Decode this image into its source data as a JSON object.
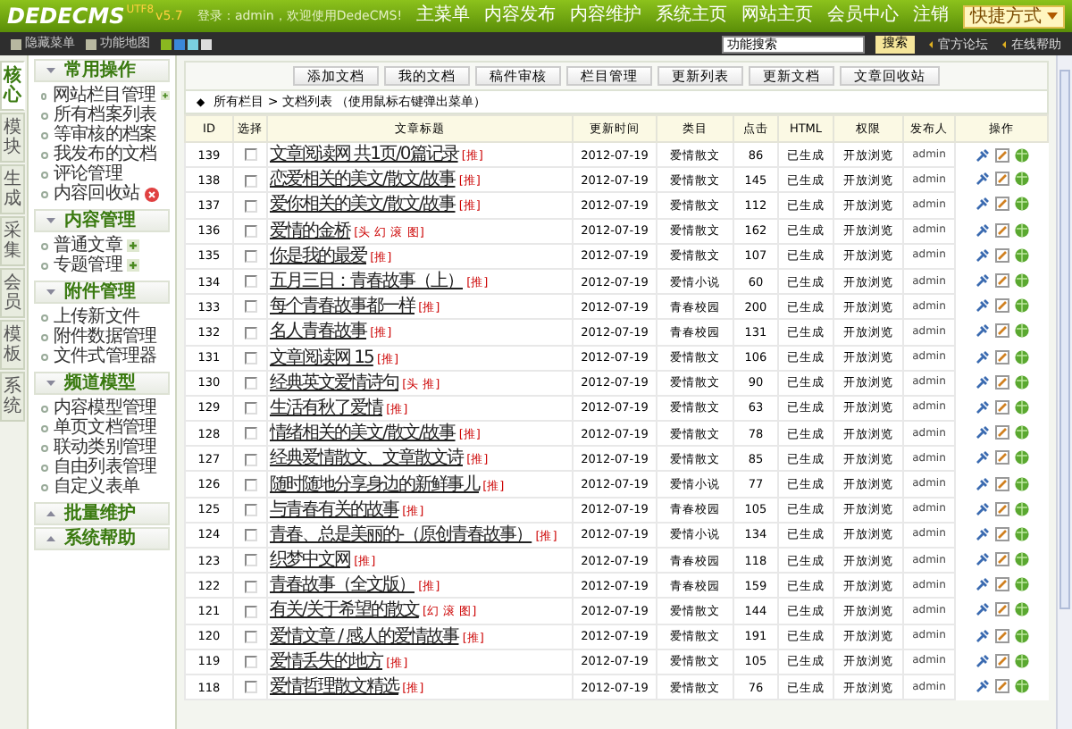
{
  "header": {
    "logo": "DEDECMS",
    "version": "v5.7",
    "edition": "UTF8",
    "welcome": "登录：admin，欢迎使用DedeCMS!",
    "nav": [
      "主菜单",
      "内容发布",
      "内容维护",
      "系统主页",
      "网站主页",
      "会员中心",
      "注销"
    ],
    "quick_menu": "快捷方式"
  },
  "toolbar": {
    "hide_menu": "隐藏菜单",
    "function_map": "功能地图",
    "search": {
      "value": "功能搜索"
    },
    "search_button": "搜索",
    "links": [
      "官方论坛",
      "在线帮助"
    ]
  },
  "side_tabs": [
    {
      "label": "核心",
      "selected": true
    },
    {
      "label": "模块",
      "selected": false
    },
    {
      "label": "生成",
      "selected": false
    },
    {
      "label": "采集",
      "selected": false
    },
    {
      "label": "会员",
      "selected": false
    },
    {
      "label": "模板",
      "selected": false
    },
    {
      "label": "系统",
      "selected": false
    }
  ],
  "sidebar": [
    {
      "title": "常用操作",
      "expanded": true,
      "items": [
        {
          "label": "网站栏目管理",
          "kind": "add"
        },
        {
          "label": "所有档案列表",
          "kind": "plain"
        },
        {
          "label": "等审核的档案",
          "kind": "plain"
        },
        {
          "label": "我发布的文档",
          "kind": "plain"
        },
        {
          "label": "评论管理",
          "kind": "plain"
        },
        {
          "label": "内容回收站",
          "kind": "delete"
        }
      ]
    },
    {
      "title": "内容管理",
      "expanded": true,
      "items": [
        {
          "label": "普通文章",
          "kind": "add"
        },
        {
          "label": "专题管理",
          "kind": "add"
        }
      ]
    },
    {
      "title": "附件管理",
      "expanded": true,
      "items": [
        {
          "label": "上传新文件",
          "kind": "plain"
        },
        {
          "label": "附件数据管理",
          "kind": "plain"
        },
        {
          "label": "文件式管理器",
          "kind": "plain"
        }
      ]
    },
    {
      "title": "频道模型",
      "expanded": true,
      "items": [
        {
          "label": "内容模型管理",
          "kind": "plain"
        },
        {
          "label": "单页文档管理",
          "kind": "plain"
        },
        {
          "label": "联动类别管理",
          "kind": "plain"
        },
        {
          "label": "自由列表管理",
          "kind": "plain"
        },
        {
          "label": "自定义表单",
          "kind": "plain"
        }
      ]
    },
    {
      "title": "批量维护",
      "expanded": false
    },
    {
      "title": "系统帮助",
      "expanded": false
    }
  ],
  "actions": [
    "添加文档",
    "我的文档",
    "稿件审核",
    "栏目管理",
    "更新列表",
    "更新文档",
    "文章回收站"
  ],
  "breadcrumb_marker": "◆",
  "breadcrumb": "所有栏目 > 文档列表 （使用鼠标右键弹出菜单）",
  "table": {
    "columns": [
      "ID",
      "选择",
      "文章标题",
      "更新时间",
      "类目",
      "点击",
      "HTML",
      "权限",
      "发布人",
      "操作"
    ],
    "rows": [
      {
        "id": "139",
        "selected": false,
        "title": "文章阅读网 共1页/0篇记录",
        "flags": "[推]",
        "date": "2012-07-19",
        "category": "爱情散文",
        "clicks": "86",
        "html": "已生成",
        "access": "开放浏览",
        "author": "admin"
      },
      {
        "id": "138",
        "selected": false,
        "title": "恋爱相关的美文/散文/故事",
        "flags": "[推]",
        "date": "2012-07-19",
        "category": "爱情散文",
        "clicks": "145",
        "html": "已生成",
        "access": "开放浏览",
        "author": "admin"
      },
      {
        "id": "137",
        "selected": false,
        "title": "爱你相关的美文/散文/故事",
        "flags": "[推]",
        "date": "2012-07-19",
        "category": "爱情散文",
        "clicks": "112",
        "html": "已生成",
        "access": "开放浏览",
        "author": "admin"
      },
      {
        "id": "136",
        "selected": false,
        "title": "爱情的金桥",
        "flags": "[头 幻 滚 图]",
        "date": "2012-07-19",
        "category": "爱情散文",
        "clicks": "162",
        "html": "已生成",
        "access": "开放浏览",
        "author": "admin"
      },
      {
        "id": "135",
        "selected": false,
        "title": "你是我的最爱",
        "flags": "[推]",
        "date": "2012-07-19",
        "category": "爱情散文",
        "clicks": "107",
        "html": "已生成",
        "access": "开放浏览",
        "author": "admin"
      },
      {
        "id": "134",
        "selected": false,
        "title": "五月三日：青春故事（上）",
        "flags": "[推]",
        "date": "2012-07-19",
        "category": "爱情小说",
        "clicks": "60",
        "html": "已生成",
        "access": "开放浏览",
        "author": "admin"
      },
      {
        "id": "133",
        "selected": false,
        "title": "每个青春故事都一样",
        "flags": "[推]",
        "date": "2012-07-19",
        "category": "青春校园",
        "clicks": "200",
        "html": "已生成",
        "access": "开放浏览",
        "author": "admin"
      },
      {
        "id": "132",
        "selected": false,
        "title": "名人青春故事",
        "flags": "[推]",
        "date": "2012-07-19",
        "category": "青春校园",
        "clicks": "131",
        "html": "已生成",
        "access": "开放浏览",
        "author": "admin"
      },
      {
        "id": "131",
        "selected": false,
        "title": "文章阅读网 15",
        "flags": "[推]",
        "date": "2012-07-19",
        "category": "爱情散文",
        "clicks": "106",
        "html": "已生成",
        "access": "开放浏览",
        "author": "admin"
      },
      {
        "id": "130",
        "selected": false,
        "title": "经典英文爱情诗句",
        "flags": "[头 推]",
        "date": "2012-07-19",
        "category": "爱情散文",
        "clicks": "90",
        "html": "已生成",
        "access": "开放浏览",
        "author": "admin"
      },
      {
        "id": "129",
        "selected": false,
        "title": "生活有秋了爱情",
        "flags": "[推]",
        "date": "2012-07-19",
        "category": "爱情散文",
        "clicks": "63",
        "html": "已生成",
        "access": "开放浏览",
        "author": "admin"
      },
      {
        "id": "128",
        "selected": false,
        "title": "情绪相关的美文/散文/故事",
        "flags": "[推]",
        "date": "2012-07-19",
        "category": "爱情散文",
        "clicks": "78",
        "html": "已生成",
        "access": "开放浏览",
        "author": "admin"
      },
      {
        "id": "127",
        "selected": false,
        "title": "经典爱情散文、文章散文诗",
        "flags": "[推]",
        "date": "2012-07-19",
        "category": "爱情散文",
        "clicks": "85",
        "html": "已生成",
        "access": "开放浏览",
        "author": "admin"
      },
      {
        "id": "126",
        "selected": false,
        "title": "随时随地分享身边的新鲜事儿",
        "flags": "[推]",
        "date": "2012-07-19",
        "category": "爱情小说",
        "clicks": "77",
        "html": "已生成",
        "access": "开放浏览",
        "author": "admin"
      },
      {
        "id": "125",
        "selected": false,
        "title": "与青春有关的故事",
        "flags": "[推]",
        "date": "2012-07-19",
        "category": "青春校园",
        "clicks": "105",
        "html": "已生成",
        "access": "开放浏览",
        "author": "admin"
      },
      {
        "id": "124",
        "selected": false,
        "title": "青春、总是美丽的-（原创青春故事）",
        "flags": "[推]",
        "date": "2012-07-19",
        "category": "爱情小说",
        "clicks": "134",
        "html": "已生成",
        "access": "开放浏览",
        "author": "admin"
      },
      {
        "id": "123",
        "selected": false,
        "title": "织梦中文网",
        "flags": "[推]",
        "date": "2012-07-19",
        "category": "青春校园",
        "clicks": "118",
        "html": "已生成",
        "access": "开放浏览",
        "author": "admin"
      },
      {
        "id": "122",
        "selected": false,
        "title": "青春故事（全文版）",
        "flags": "[推]",
        "date": "2012-07-19",
        "category": "青春校园",
        "clicks": "159",
        "html": "已生成",
        "access": "开放浏览",
        "author": "admin"
      },
      {
        "id": "121",
        "selected": false,
        "title": "有关/关于希望的散文",
        "flags": "[幻 滚 图]",
        "date": "2012-07-19",
        "category": "爱情散文",
        "clicks": "144",
        "html": "已生成",
        "access": "开放浏览",
        "author": "admin"
      },
      {
        "id": "120",
        "selected": false,
        "title": "爱情文章 / 感人的爱情故事",
        "flags": "[推]",
        "date": "2012-07-19",
        "category": "爱情散文",
        "clicks": "191",
        "html": "已生成",
        "access": "开放浏览",
        "author": "admin"
      },
      {
        "id": "119",
        "selected": false,
        "title": "爱情丢失的地方",
        "flags": "[推]",
        "date": "2012-07-19",
        "category": "爱情散文",
        "clicks": "105",
        "html": "已生成",
        "access": "开放浏览",
        "author": "admin"
      },
      {
        "id": "118",
        "selected": false,
        "title": "爱情哲理散文精选",
        "flags": "[推]",
        "date": "2012-07-19",
        "category": "爱情散文",
        "clicks": "76",
        "html": "已生成",
        "access": "开放浏览",
        "author": "admin"
      }
    ]
  }
}
